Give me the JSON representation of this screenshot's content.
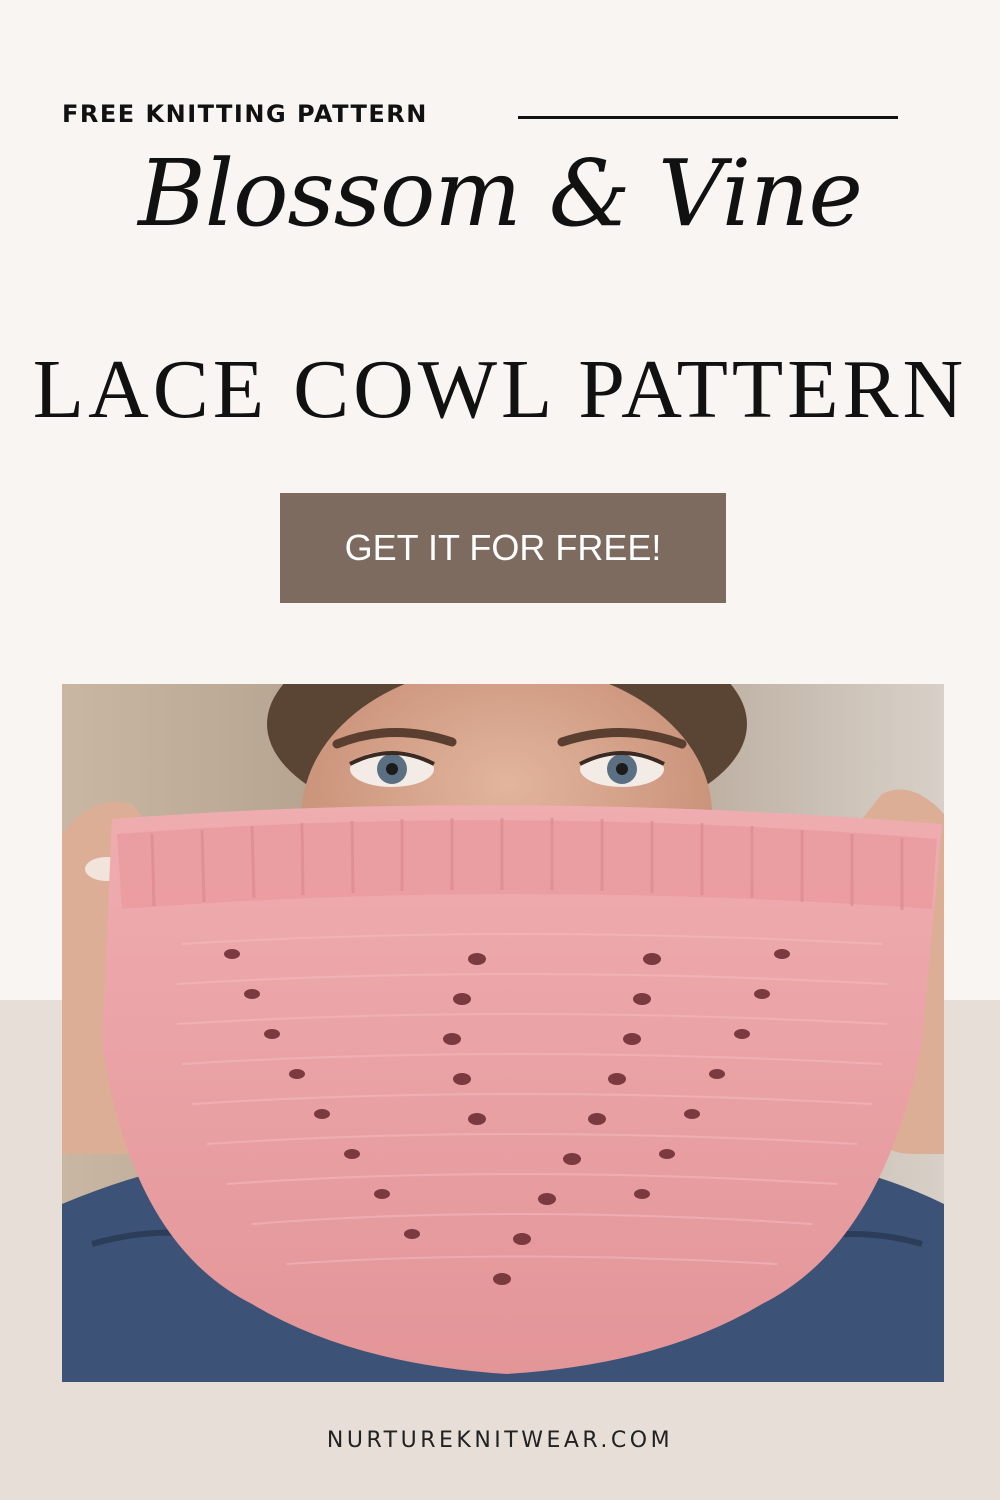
{
  "header": {
    "kicker": "FREE KNITTING PATTERN",
    "script_title": "Blossom & Vine",
    "title": "LACE COWL PATTERN"
  },
  "cta": {
    "label": "GET IT FOR FREE!"
  },
  "photo": {
    "subject": "woman holding pink lace knit cowl over face"
  },
  "footer": {
    "site": "NURTUREKNITWEAR.COM"
  },
  "colors": {
    "background_top": "#f8f5f2",
    "background_bottom": "#e6ded7",
    "button": "#7e6b60",
    "cowl_pink": "#eba3a7",
    "denim": "#3c5276"
  }
}
